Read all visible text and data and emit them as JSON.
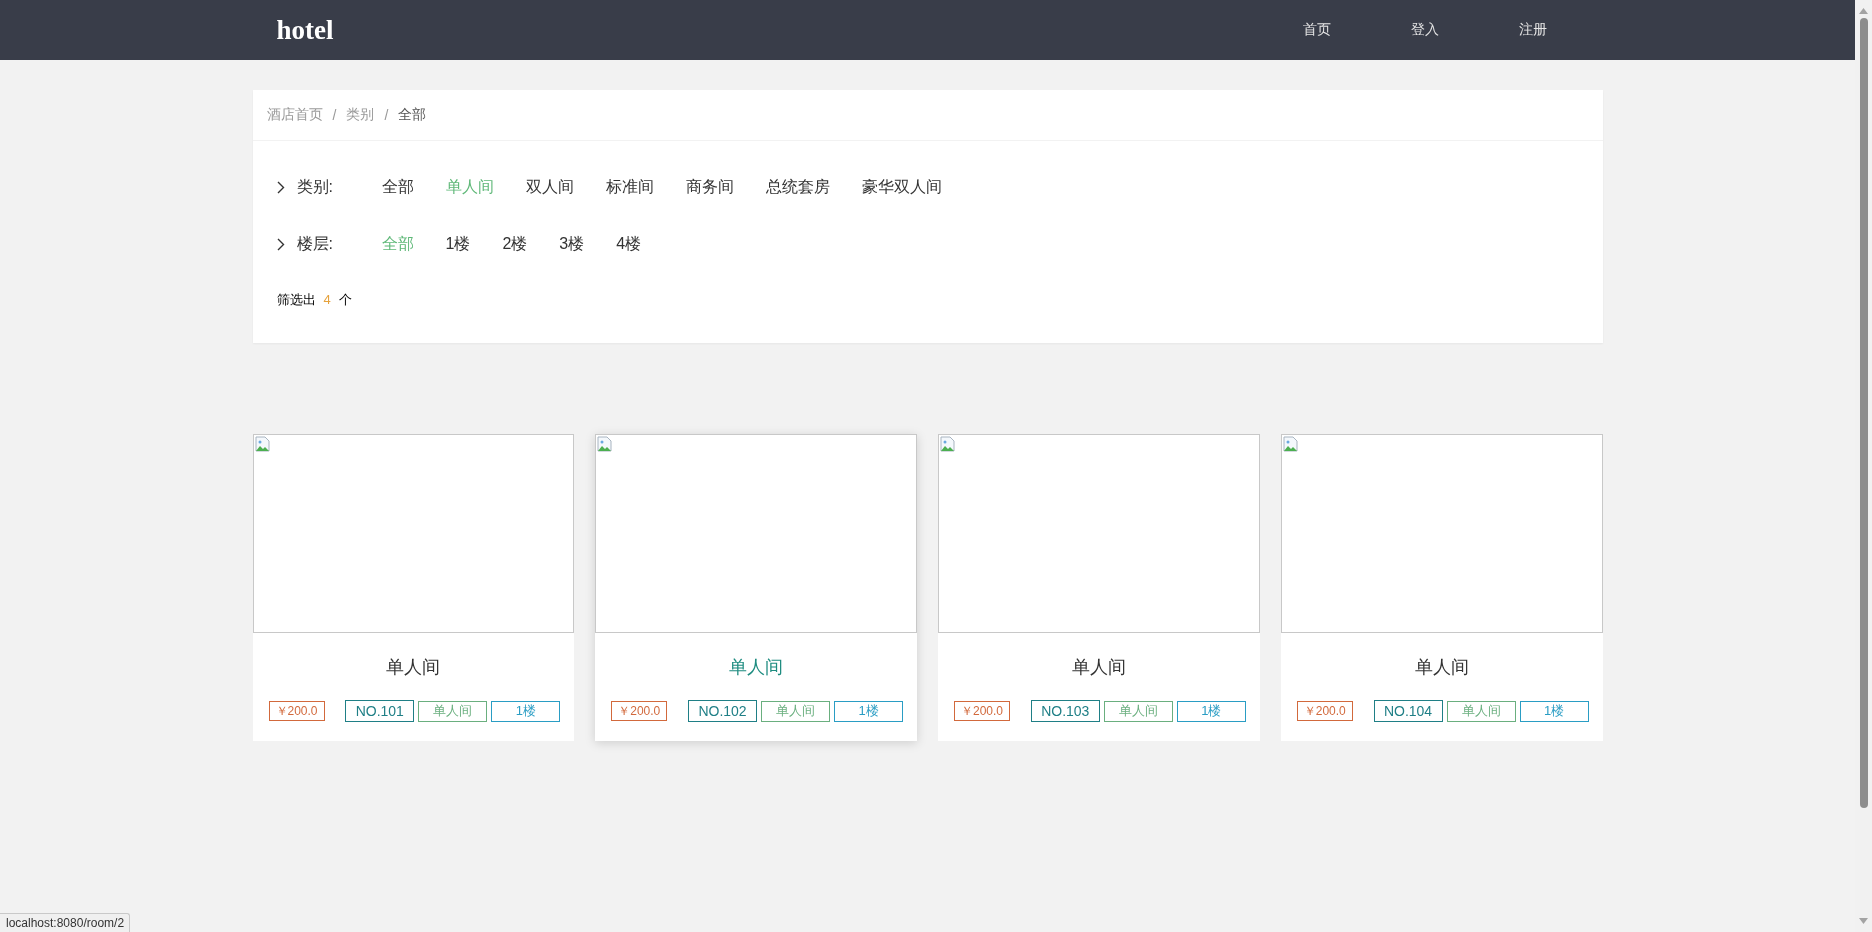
{
  "header": {
    "logo": "hotel",
    "nav": [
      "首页",
      "登入",
      "注册"
    ]
  },
  "breadcrumb": {
    "separator": "/",
    "items": [
      "酒店首页",
      "类别",
      "全部"
    ]
  },
  "filters": [
    {
      "label": "类别:",
      "options": [
        {
          "label": "全部",
          "selected": false
        },
        {
          "label": "单人间",
          "selected": true
        },
        {
          "label": "双人间",
          "selected": false
        },
        {
          "label": "标准间",
          "selected": false
        },
        {
          "label": "商务间",
          "selected": false
        },
        {
          "label": "总统套房",
          "selected": false
        },
        {
          "label": "豪华双人间",
          "selected": false
        }
      ]
    },
    {
      "label": "楼层:",
      "options": [
        {
          "label": "全部",
          "selected": true
        },
        {
          "label": "1楼",
          "selected": false
        },
        {
          "label": "2楼",
          "selected": false
        },
        {
          "label": "3楼",
          "selected": false
        },
        {
          "label": "4楼",
          "selected": false
        }
      ]
    }
  ],
  "result": {
    "prefix": "筛选出",
    "count": "4",
    "suffix": "个"
  },
  "rooms": [
    {
      "title": "单人间",
      "hovered": false,
      "tags": [
        {
          "kind": "price",
          "text": "￥200.0"
        },
        {
          "kind": "number",
          "text": "NO.101"
        },
        {
          "kind": "type",
          "text": "单人间"
        },
        {
          "kind": "floor",
          "text": "1楼"
        }
      ]
    },
    {
      "title": "单人间",
      "hovered": true,
      "tags": [
        {
          "kind": "price",
          "text": "￥200.0"
        },
        {
          "kind": "number",
          "text": "NO.102"
        },
        {
          "kind": "type",
          "text": "单人间"
        },
        {
          "kind": "floor",
          "text": "1楼"
        }
      ]
    },
    {
      "title": "单人间",
      "hovered": false,
      "tags": [
        {
          "kind": "price",
          "text": "￥200.0"
        },
        {
          "kind": "number",
          "text": "NO.103"
        },
        {
          "kind": "type",
          "text": "单人间"
        },
        {
          "kind": "floor",
          "text": "1楼"
        }
      ]
    },
    {
      "title": "单人间",
      "hovered": false,
      "tags": [
        {
          "kind": "price",
          "text": "￥200.0"
        },
        {
          "kind": "number",
          "text": "NO.104"
        },
        {
          "kind": "type",
          "text": "单人间"
        },
        {
          "kind": "floor",
          "text": "1楼"
        }
      ]
    }
  ],
  "status_bar": {
    "url": "localhost:8080/room/2"
  }
}
